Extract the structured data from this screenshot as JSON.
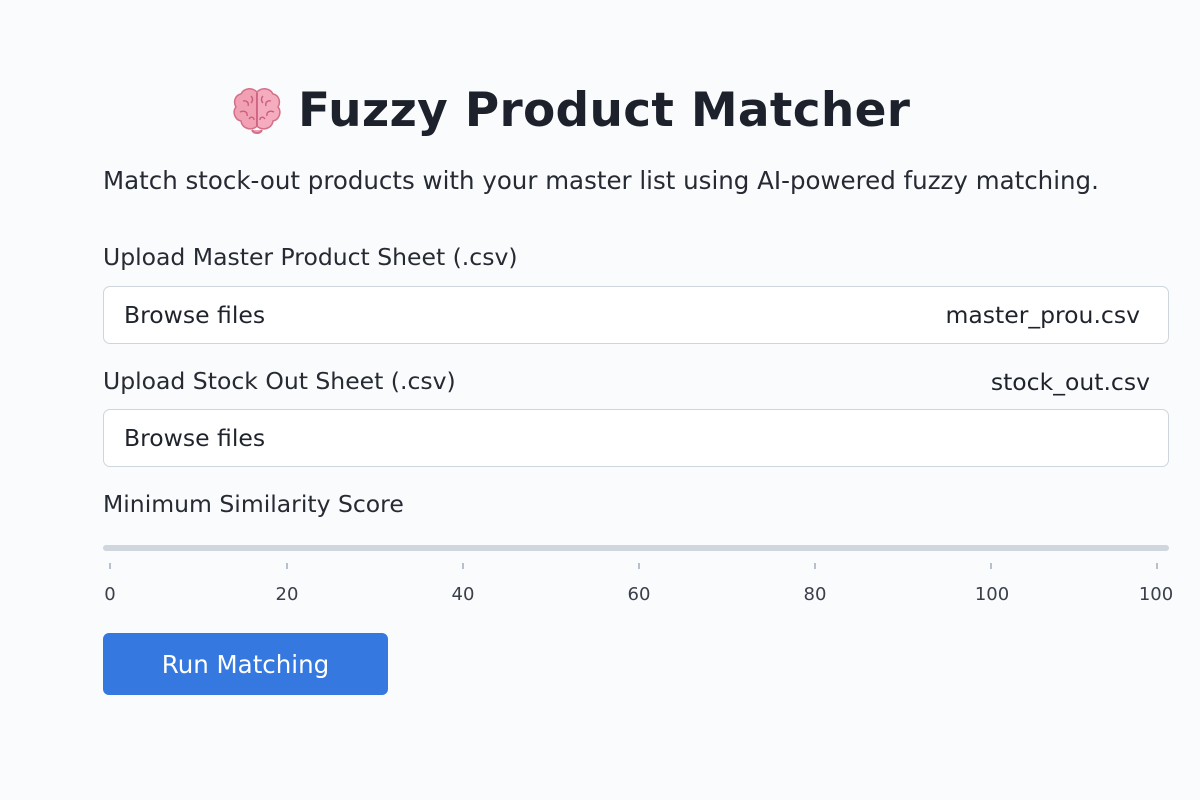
{
  "header": {
    "emoji_icon": "brain-icon",
    "title": "Fuzzy Product Matcher"
  },
  "subtitle": "Match stock-out products with your master list using AI-powered fuzzy matching.",
  "master_upload": {
    "label": "Upload Master Product Sheet (.csv)",
    "browse_label": "Browse files",
    "file_name": "master_prou.csv"
  },
  "stock_upload": {
    "label": "Upload Stock Out Sheet (.csv)",
    "browse_label": "Browse files",
    "file_name": "stock_out.csv"
  },
  "similarity": {
    "label": "Minimum Similarity Score",
    "min": 0,
    "max": 100,
    "ticks": [
      "0",
      "20",
      "40",
      "60",
      "80",
      "100",
      "100"
    ]
  },
  "actions": {
    "run_label": "Run Matching"
  },
  "colors": {
    "accent": "#3578df",
    "background": "#fafbfc",
    "border": "#cfd5dd"
  }
}
